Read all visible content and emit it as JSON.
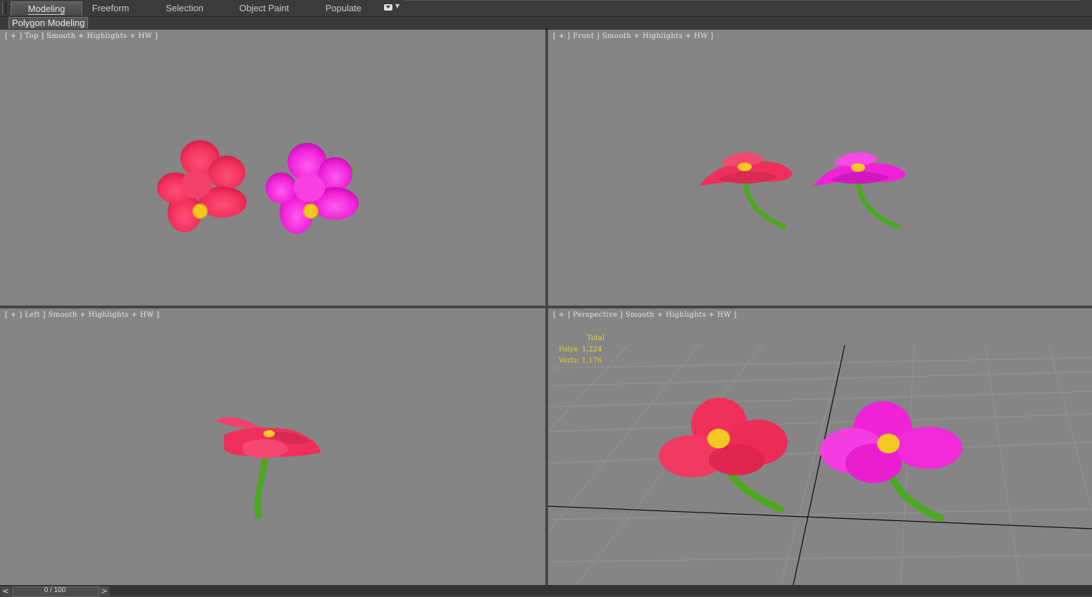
{
  "ribbon": {
    "tabs": [
      {
        "label": "Modeling",
        "active": true
      },
      {
        "label": "Freeform",
        "active": false
      },
      {
        "label": "Selection",
        "active": false
      },
      {
        "label": "Object Paint",
        "active": false
      },
      {
        "label": "Populate",
        "active": false
      }
    ],
    "dropdown_icon": "panel-toggle-icon"
  },
  "subribbon": {
    "active_panel": "Polygon Modeling"
  },
  "viewports": {
    "top": {
      "label": "[ + ] Top ] Smooth + Highlights + HW ]"
    },
    "front": {
      "label": "[ + ] Front ] Smooth + Highlights + HW ]"
    },
    "left": {
      "label": "[ + ] Left ] Smooth + Highlights + HW ]"
    },
    "perspective": {
      "label": "[ + ] Perspective ] Smooth + Highlights + HW ]",
      "stats": {
        "title": "Total",
        "polys": "Polys: 1,224",
        "verts": "Verts: 1,176"
      }
    }
  },
  "time_slider": {
    "value": "0 / 100",
    "prev": "<",
    "next": ">"
  },
  "colors": {
    "viewport_bg": "#858585",
    "flower_red": "#f0305a",
    "flower_magenta": "#f022d8",
    "stem_green": "#4ca820",
    "pistil_yellow": "#f3c820",
    "stats_text": "#e6d23c"
  }
}
